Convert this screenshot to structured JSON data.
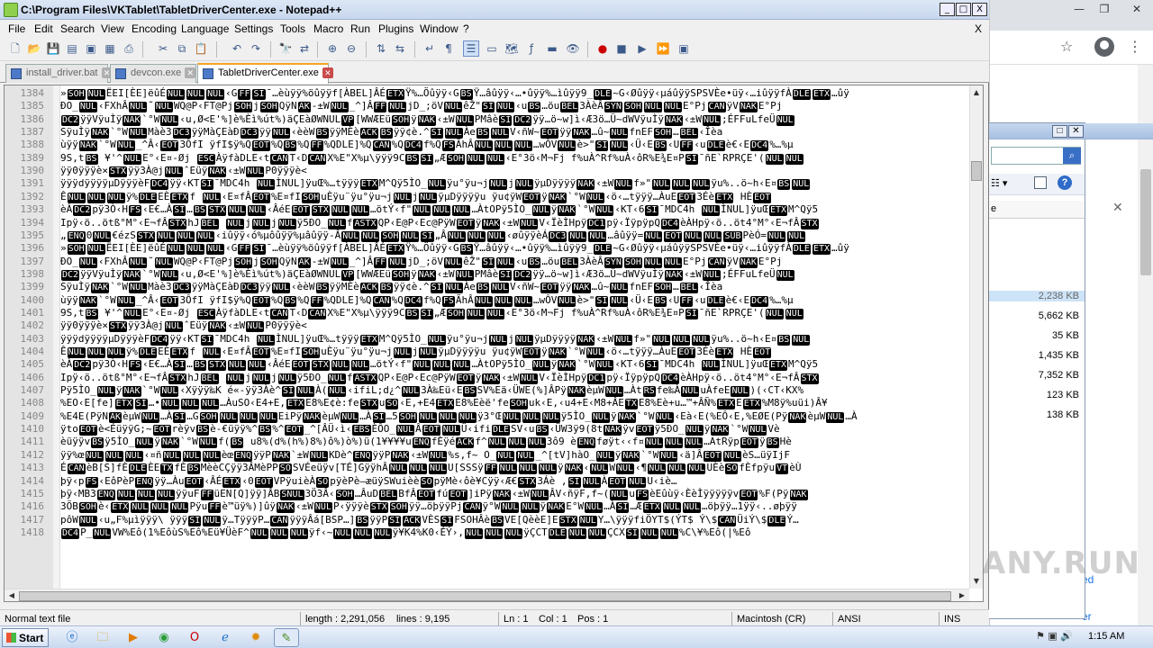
{
  "window": {
    "title": "C:\\Program Files\\VKTablet\\TabletDriverCenter.exe - Notepad++",
    "min": "_",
    "max": "□",
    "close": "X"
  },
  "menu": [
    "File",
    "Edit",
    "Search",
    "View",
    "Encoding",
    "Language",
    "Settings",
    "Tools",
    "Macro",
    "Run",
    "Plugins",
    "Window",
    "?"
  ],
  "menu_close": "X",
  "tabs": [
    {
      "label": "install_driver.bat",
      "active": false
    },
    {
      "label": "devcon.exe",
      "active": false
    },
    {
      "label": "TabletDriverCenter.exe",
      "active": true
    }
  ],
  "editor": {
    "lines": [
      {
        "n": "1384",
        "text": "»[SOH][NUL]ËEI[ÈE]ëûÉ[NUL][NUL][NUL]‹G[FF][SI]¯…èùÿÿ%öûÿÿf[ÀBEL]ÂÉ[ETX]Ÿ%…Öûÿÿ‹G[BS]Ÿ…âûÿÿ‹…•ûÿÿ%…ìûÿÿ9_[DLE]~G‹Øûÿÿ‹µáûÿÿSPSVÈe•üÿ‹…iûÿÿfÀ[DLE][ETX]…ûÿ"
      },
      {
        "n": "1385",
        "text": "ÐO_[NUL]‹FXhÂ[NUL]˜[NUL]WQ@P‹FT@Pj[SOH]j[SOH]QÿN[AK]-±W[NUL]_^]Â[FF][NUL]jD_;öV[NUL]êŽ\"[SI][NUL]‹u[BS]…öu[BEL]3ÀèÂ[SYN][SOH][NUL][NUL]E°Pj[CAN]ÿV[NAK]E°Pj"
      },
      {
        "n": "1386",
        "text": "[DC2]ÿÿVÿuÌÿ[NAK]`°W[NUL]‹u‚Ø<E'%]è%Èì%út%)äÇEàØWNUL[VP][WWÆEü[SOH]ÿ[NAK]‹±W[NUL]PMâè[SI][DC2]ÿÿ…ö~w]ì‹Æ3ö…Ü~dWVÿuÌÿ[NAK]‹±W[NUL];ÉFFuLfeÜ[NUL]"
      },
      {
        "n": "1387",
        "text": "SÿuÌÿ[NAK]`°W[NUL]Màè3[DC3]ÿÿMàÇEàÐ[DC3]ÿÿ[NUL]‹èèW[BS]ÿÿMÈè[ACK][BS]ÿÿ¢è.^[SI][NUL]Àe[BS][NUL]V‹ñW~[EOT]ÿÿ[NAK]…û~[NUL]fnEF[SOH]…[BEL]‹Îèa"
      },
      {
        "n": "1388",
        "text": "ùÿÿ[NAK]`°W[NUL]_^Â‹[EOT]3ÔfI ÿfI$ÿ%Q[EOT]%Q[BS]%Q[FF]%QDLE]%Q[CAN]%Q[DC4]f%Q[FS]ÃhÂ[NUL][NUL][NUL]…wÔV[NUL]è>\"[SI][NUL]‹Ü‹E[BS]‹U[FF]‹u[DLE]è€‹E[DC4]%…%µ"
      },
      {
        "n": "1389",
        "text": "9S,t[BS] ¥'^[NUL]E°‹E¤-Øj [ESC]ÀÿfàDLE‹t[CAN]T‹D[CAN]X%E\"X%µ\\ÿÿÿ9C[BS][SI]„Æ[SOH][NUL][NUL]‹E°3ö‹M¬Fj f%uÀ^Rf%uÀ‹ôR%E¾E¤P[SI]¯ñE`RPRÇE'([NUL][NUL]"
      },
      {
        "n": "1390",
        "text": "ÿÿ0ÿÿÿè×[STX]ÿÿ3À@j[NUL]ˆEüÿ[NAK]‹±W[NUL]P0ÿÿÿè<"
      },
      {
        "n": "1391",
        "text": "ÿÿÿdÿÿÿÿµDÿÿÿèF[DC4]ÿÿ‹KT[SI]¯MDC4h [NUL]ÌNUL]ÿuŒ%…tÿÿÿ[ETX]M^Qÿ5ÌO_[NUL]ÿu°ÿu¬j[NUL]j[NUL]ÿµDÿÿÿÿ[NAK]‹±W[NUL]f»\"[NUL][NUL][NUL]ÿu%..ö~h‹E¤[BS][NUL]"
      },
      {
        "n": "1392",
        "text": "Ê[NUL][NUL][NUL]ÿ%[DLE]EÈ[ETX]f [NUL]‹E¤fÂ[EOT]%E¤fI[SOH]uÈÿu¨ÿu°ÿu¬j[NUL]j[NUL]ÿµDÿÿÿÿu ÿu¢ÿW[EOT]ÿ[NAK]`°W[NUL]‹ö‹…tÿÿÿ…ÀuE[EOT]3Éè[ETX] HÈ[EOT]"
      },
      {
        "n": "1393",
        "text": "èÀ[DC2]pÿ3Ò‹H[FS]‹E€…À[SI]…[BS][STX][NUL][NUL]‹ÂéE[EOT][STX][NUL][NUL]…ötÝ‹f\"[NUL][NUL][NUL]…ÀtOPÿ5ÌO_[NUL]ÿ[NAK]`°W[NUL]‹KT‹6[SI]¯MDC4h [NUL]ÌNUL]ÿuŒ[ETX]M^Qÿ5"
      },
      {
        "n": "1394",
        "text": "Ipÿ‹ö..ötß°M°‹E¬fÂ[STX]hJ[BEL] [NUL]j[NUL]j[NUL]ÿ5ÐO_[NUL]f[ASTX]QP‹E@P‹Ec@PÿW[EOT]ÿ[NAK]‹±W[NUL]V‹ÏèÌHpÿ[DC1]pÿ‹ÏÿpÿpQ[DC4]èÀHpÿ‹ö..öt4°M°‹E¬fÂ[STX]"
      },
      {
        "n": "1395",
        "text": "„[ENQ]0[NUL]€ézS[STX][NUL][NUL][NUL]‹iûÿÿ‹ó%µôûÿÿ%µâûÿÿ-Â[NUL][NUL][SOH][NUL][SI]„Â[NUL][NUL][NUL]‹øûÿÿèÁ[DC3][NUL][NUL]…âûÿÿ=[NUL][EOT][NUL][NUL][SUB]PèÓ=[NUL][NUL]"
      },
      {
        "n": "1396",
        "text": "»[SOH][NUL]ËEI[ÈE]ëûÉ[NUL][NUL][NUL]‹G[FF][SI]¯…èùÿÿ%öûÿÿf[ÀBEL]ÂÉ[ETX]Ÿ%…Öûÿÿ‹G[BS]Ÿ…âûÿÿ‹…•ûÿÿ%…ìûÿÿ9_[DLE]~G‹Øûÿÿ‹µáûÿÿSPSVÈe•üÿ‹…iûÿÿfÀ[DLE][ETX]…ûÿ"
      },
      {
        "n": "1397",
        "text": "ÐO_[NUL]‹FXhÂ[NUL]˜[NUL]WQ@P‹FT@Pj[SOH]j[SOH]QÿN[AK]-±W[NUL]_^]Â[FF][NUL]jD_;öV[NUL]êŽ\"[SI][NUL]‹u[BS]…öu[BEL]3ÀèÂ[SYN][SOH][NUL][NUL]E°Pj[CAN]ÿV[NAK]E°Pj"
      },
      {
        "n": "1398",
        "text": "[DC2]ÿÿVÿuÌÿ[NAK]`°W[NUL]‹u‚Ø<E'%]è%Èì%út%)äÇEàØWNUL[VP][WWÆEü[SOH]ÿ[NAK]‹±W[NUL]PMâè[SI][DC2]ÿÿ…ö~w]ì‹Æ3ö…Ü~dWVÿuÌÿ[NAK]‹±W[NUL];ÉFFuLfeÜ[NUL]"
      },
      {
        "n": "1399",
        "text": "SÿuÌÿ[NAK]`°W[NUL]Màè3[DC3]ÿÿMàÇEàÐ[DC3]ÿÿ[NUL]‹èèW[BS]ÿÿMÈè[ACK][BS]ÿÿ¢è.^[SI][NUL]Àe[BS][NUL]V‹ñW~[EOT]ÿÿ[NAK]…û~[NUL]fnEF[SOH]…[BEL]‹Îèa"
      },
      {
        "n": "1400",
        "text": "ùÿÿ[NAK]`°W[NUL]_^Â‹[EOT]3ÔfI ÿfI$ÿ%Q[EOT]%Q[BS]%Q[FF]%QDLE]%Q[CAN]%Q[DC4]f%Q[FS]ÃhÂ[NUL][NUL][NUL]…wÔV[NUL]è>\"[SI][NUL]‹Ü‹E[BS]‹U[FF]‹u[DLE]è€‹E[DC4]%…%µ"
      },
      {
        "n": "1401",
        "text": "9S,t[BS] ¥'^[NUL]E°‹E¤-Øj [ESC]ÀÿfàDLE‹t[CAN]T‹D[CAN]X%E\"X%µ\\ÿÿÿ9C[BS][SI]„Æ[SOH][NUL][NUL]‹E°3ö‹M¬Fj f%uÀ^Rf%uÀ‹ôR%E¾E¤P[SI]¯ñE`RPRÇE'([NUL][NUL]"
      },
      {
        "n": "1402",
        "text": "ÿÿ0ÿÿÿè×[STX]ÿÿ3À@j[NUL]ˆEüÿ[NAK]‹±W[NUL]P0ÿÿÿè<"
      },
      {
        "n": "1403",
        "text": "ÿÿÿdÿÿÿÿµDÿÿÿèF[DC4]ÿÿ‹KT[SI]¯MDC4h [NUL]ÌNUL]ÿuŒ%…tÿÿÿ[ETX]M^Qÿ5ÌO_[NUL]ÿu°ÿu¬j[NUL]j[NUL]ÿµDÿÿÿÿ[NAK]‹±W[NUL]f»\"[NUL][NUL][NUL]ÿu%..ö~h‹E¤[BS][NUL]"
      },
      {
        "n": "1404",
        "text": "Ê[NUL][NUL][NUL]ÿ%[DLE]EÈ[ETX]f [NUL]‹E¤fÂ[EOT]%E¤fI[SOH]uÈÿu¨ÿu°ÿu¬j[NUL]j[NUL]ÿµDÿÿÿÿu ÿu¢ÿW[EOT]ÿ[NAK]`°W[NUL]‹ö‹…tÿÿÿ…ÀuE[EOT]3Éè[ETX] HÈ[EOT]"
      },
      {
        "n": "1405",
        "text": "èÀ[DC2]pÿ3Ò‹H[FS]‹E€…À[SI]…[BS][STX][NUL][NUL]‹ÂéE[EOT][STX][NUL][NUL]…ötÝ‹f\"[NUL][NUL][NUL]…ÀtOPÿ5ÌO_[NUL]ÿ[NAK]`°W[NUL]‹KT‹6[SI]¯MDC4h [NUL]ÌNUL]ÿuŒ[ETX]M^Qÿ5"
      },
      {
        "n": "1406",
        "text": "Ipÿ‹ö..ötß°M°‹E¬fÂ[STX]hJ[BEL] [NUL]j[NUL]j[NUL]ÿ5ÐO_[NUL]f[ASTX]QP‹E@P‹Ec@PÿW[EOT]ÿ[NAK]‹±W[NUL]V‹ÏèÌHpÿ[DC1]pÿ‹ÏÿpÿpQ[DC4]èÀHpÿ‹ö..öt4°M°‹E¬fÂ[STX]"
      },
      {
        "n": "1407",
        "text": "Pÿ5ÌO_[NUL]ÿ[NAK]`°W[NUL]‹Xÿÿÿ‰K é«-ÿÿ3Àè^[SI][NUL]À([NUL]‹ifiL;d¿^[NUL]3À‰Eü‹E[BS]SV%Eä‹ÜWE(%]ÂPÿ[NAK]èµW[NUL]…Àt[RS]fe‰À[NUL]uÀfeE[NUL])(‹CT‹KX%"
      },
      {
        "n": "1408",
        "text": "%EO‹E[fe][ETX][SI]…•[NUL][NUL][NUL]…ÀuSO‹E4+E‚[ETX]E8%E¢è:fe[STX]u[SO]‹E‚+E4[ETX]E8%Eèë'fe[SOH]uk‹E‚‹u4+E‹M8+ÂE[TX]E8%Eè+u…™+ÂÑ%[ETX]E[ETX]%M8ÿ%uüi)Â¥"
      },
      {
        "n": "1409",
        "text": "%E4E(PÿN[AK]èµW[NUL]…À[SI]…G[SOH][NUL][NUL][NUL]EiPÿ[NAK]èµW[NUL]…À[SI]…5[SOH][NUL][NUL][NUL]ÿ3°Œ[NUL][NUL][NUL]ÿ5ÌO_[NUL]ÿ[NAK]`°W[NUL]‹Eà‹E(%EÔ‹E,%EØE(Pÿ[NAK]èµW[NUL]…À"
      },
      {
        "n": "1410",
        "text": "ÿto[EOT]è<ÉüÿÿG;~[EOT]rèÿv[BS]è-€üÿÿ%^[BS]%^[EOT]_^[ÂÜ‹ì‹[EBS]ÈÔO_[NUL]Â[EOT][NUL]Ü‹ifi[DLE]SV‹u[BS]‹ÜW3ÿ9(8t[NAK]ÿv[EOT]ÿ5ÐO_[NUL]ÿ[NAK]`°W[NUL]Vè"
      },
      {
        "n": "1411",
        "text": "èüÿÿv[BS]ÿ5ÌO_[NUL]ÿ[NAK]`°W[NUL]f([BS] u8%(d%(h%)8%)ô%)ò%)ü(1¥¥¥¥u[ENQ]fÈÿé[ACK]f^[NUL][NUL][NUL]3ô9 è[ENQ]føÿt‹‹f¤[NUL][NUL][NUL]…AtRÿp[EOT]ÿ[BS]Hè"
      },
      {
        "n": "1412",
        "text": "ÿÿ%œ[NUL][NUL][NUL]‹¤ñ[NUL][NUL][NUL]èœ[ENQ]ÿÿP[NAK]`±W[NUL]KDè^[ENQ]ÿÿP[NAK]‹±W[NUL]%s,f~ O_[NUL][NUL]_^[tV]hàO_[NUL]ÿ[NAK]`°W[NUL]‹ä]Â[EOT][NUL]èS…üÿIjF"
      },
      {
        "n": "1413",
        "text": "É[CAN]èB[S]fÈ[DLE]ÈE[TX]fÈ[BS]MèèCÇÿÿ3ÂMèPP[SO]SVÉeüÿv[TÉ]GÿÿhÂ[NUL][NUL][NUL]U[SSSÿ[FF][NUL][NUL][NUL]ÿ[NAK]‹[NUL]W[NUL]‹¶[NUL][NUL][NUL]UÈè[SO]fÈfpÿu[VT]èÙ"
      },
      {
        "n": "1414",
        "text": "þÿ‹p[FS]‹EôPèP[ENQ]ÿÿ…Àu[EOT]‹ÂÉ[ETX]‹0[EOT]VPÿuièÀ[SO]pÿèPè–æüÿSWuièè[SO]pÿMè‹ôè¥Cÿÿ‹Æ€[STX]3Áè ,[SI][NUL]À[EOT][NUL]U‹iè…"
      },
      {
        "n": "1415",
        "text": "þÿ‹MB3[ENQ][NUL][NUL][NUL]ÿÿuF[FF]üEN[Q]ÿÿ]ÂB[SNUL]3Ö3Â‹[SOH]…ÂuD[BEL]BfÂ[EOT]fú[EOT]]iPÿ[NAK]‹±W[NUL]ÂV‹ñÿF,f~([NUL]u[FS]èEûùÿ‹ÈèÌÿÿÿÿÿv[EOT]%F(Pÿ[NAK]"
      },
      {
        "n": "1416",
        "text": "3ÖB[SOH]è‹[ETX][NUL][NUL][NUL]Pÿu[FF]è™üÿ%)]ûÿ[NAK]‹±W[NUL]P‹ÿÿÿè[STX][SOH]ÿÿ…öþÿÿPj[CAN]ÿ°W[NUL][NUL]ÿ[NAK]E°W[NUL]…À[SI]…Æ[ETX][NUL][NUL]…öþÿÿ…1ÿÿ‹..øþÿÿ"
      },
      {
        "n": "1417",
        "text": "pôW[NUL]‹u„F%µìÿÿÿ\\ ÿÿÿ[SI][NUL]ÿ…TÿÿÿP…[CAN]ÿÿÿÂá[BSP…][BS]ÿÿP[SI][ACK]VÈS[SI]FSOHÂè[BS]VE[QèèE]E[STX][NUL]Y…\\ÿÿÿfiÖYT$(ÝT$ Ý\\$[CAN]ÜiÝ\\$[DLE]Ý…"
      },
      {
        "n": "1418",
        "text": "[DC4]P_[NUL]VW%Eô(1%EôùS%Eô%Eü¥ÜèF^[NUL][NUL][NUL]ÿf‹~[NUL][NUL][NUL]ÿ¥K4%K0‹ÉÝ›,[NUL][NUL][NUL]ÿÇCT[DLE][NUL][NUL]ÇCX[SI][NUL][NUL]%C\\¥%Eô(|%Eô"
      }
    ]
  },
  "status": {
    "filetype": "Normal text file",
    "length": "length : 2,291,056",
    "lines": "lines : 9,195",
    "ln": "Ln : 1",
    "col": "Col : 1",
    "pos": "Pos : 1",
    "eol": "Macintosh (CR)",
    "encoding": "ANSI",
    "mode": "INS"
  },
  "explorer": {
    "column": "e",
    "sizes": [
      "2,238 KB",
      "5,662 KB",
      "35 KB",
      "1,435 KB",
      "7,352 KB",
      "123 KB",
      "138 KB"
    ]
  },
  "browser": {
    "link1": "ed",
    "link2": "er"
  },
  "taskbar": {
    "start": "Start",
    "clock": "1:15 AM"
  },
  "watermark": "ANY.RUN"
}
